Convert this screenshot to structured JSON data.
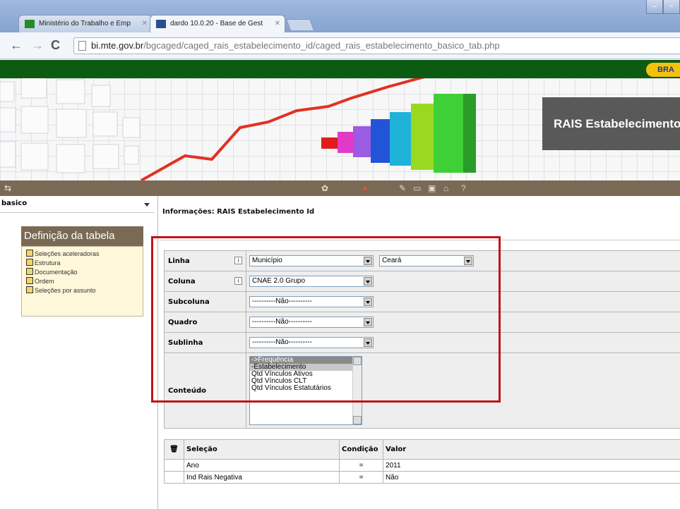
{
  "browser": {
    "tabs": [
      {
        "title": "Ministério do Trabalho e Emp"
      },
      {
        "title": "dardo 10.0.20 - Base de Gest"
      }
    ],
    "url_host": "bi.mte.gov.br",
    "url_path": "/bgcaged/caged_rais_estabelecimento_id/caged_rais_estabelecimento_basico_tab.php"
  },
  "header": {
    "brasil_label": "BRA",
    "banner_title": "RAIS Estabelecimento"
  },
  "sidebar": {
    "selected": "basico",
    "panel_title": "Definição da tabela",
    "items": [
      {
        "label": "Seleções aceleradoras"
      },
      {
        "label": "Estrutura"
      },
      {
        "label": "Documentação"
      },
      {
        "label": "Ordem"
      },
      {
        "label": "Seleções por assunto"
      }
    ]
  },
  "main": {
    "info_title": "Informações: RAIS Estabelecimento Id",
    "info_icon_glyph": "i",
    "rows": {
      "linha": {
        "label": "Linha",
        "value": "Município",
        "value2": "Ceará"
      },
      "coluna": {
        "label": "Coluna",
        "value": "CNAE 2.0 Grupo"
      },
      "subcoluna": {
        "label": "Subcoluna",
        "value": "----------Não----------"
      },
      "quadro": {
        "label": "Quadro",
        "value": "----------Não----------"
      },
      "sublinha": {
        "label": "Sublinha",
        "value": "----------Não----------"
      },
      "conteudo": {
        "label": "Conteúdo",
        "options": [
          "->Frequência",
          "-Estabelecimento",
          "Qtd Vínculos Ativos",
          "Qtd Vínculos CLT",
          "Qtd Vínculos Estatutários"
        ]
      }
    },
    "selection_table": {
      "headers": [
        "Seleção",
        "Condição",
        "Valor"
      ],
      "rows": [
        {
          "selecao": "Ano",
          "condicao": "=",
          "valor": "2011"
        },
        {
          "selecao": "Ind Rais Negativa",
          "condicao": "=",
          "valor": "Não"
        }
      ]
    }
  },
  "colors": {
    "highlight": "#c1131a",
    "toolbar_brown": "#7a6a55",
    "header_green": "#0d5a12"
  }
}
